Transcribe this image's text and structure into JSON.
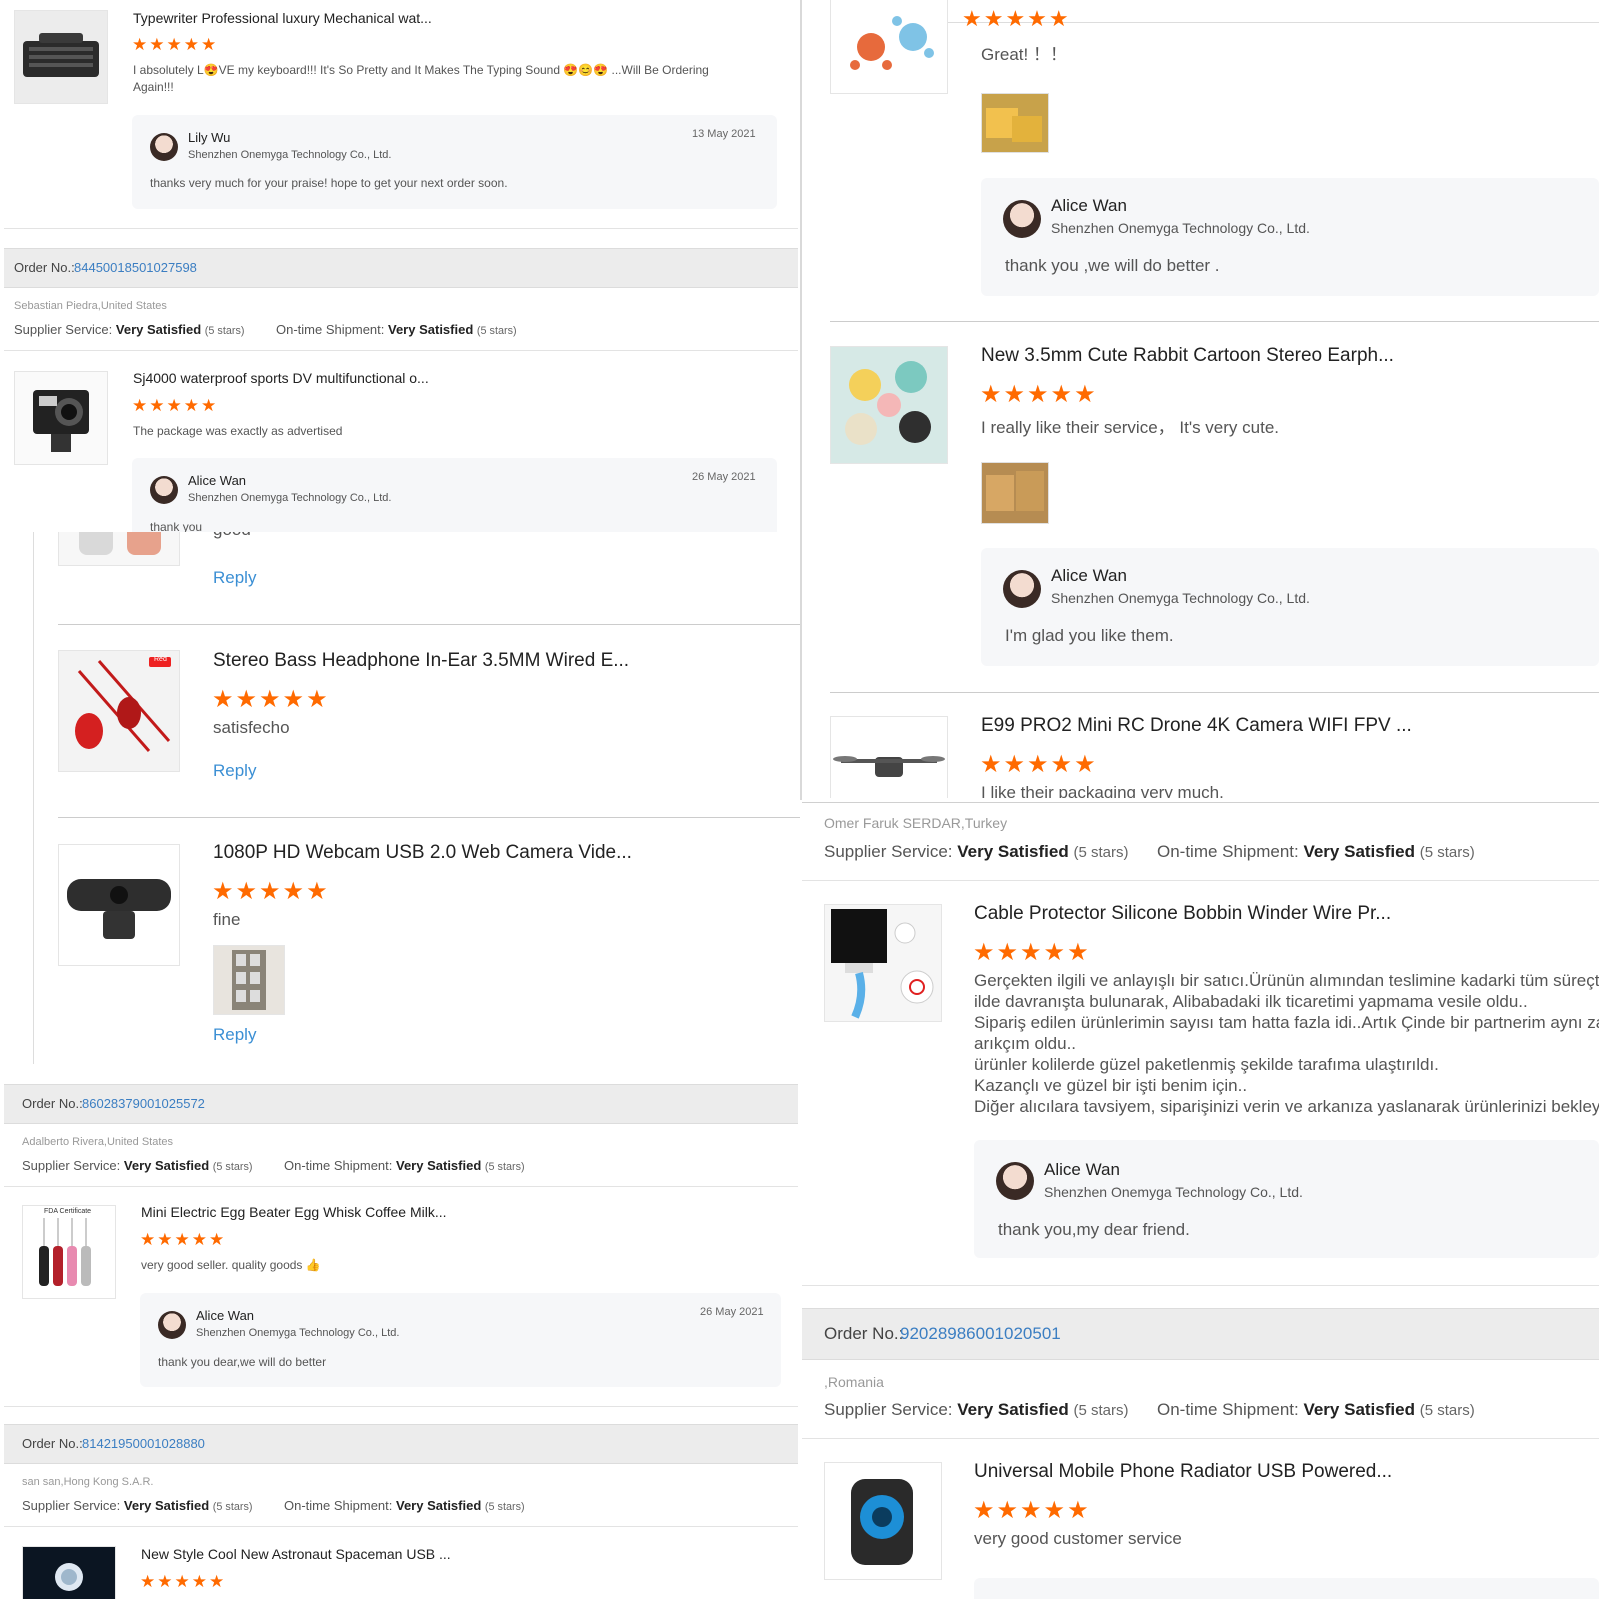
{
  "panel_a": {
    "review1": {
      "title": "Typewriter Professional luxury Mechanical wat...",
      "stars": "★★★★★",
      "text_l1": "I absolutely L😍VE my keyboard!!! It's So Pretty and It Makes The Typing Sound 😍😊😍 ...Will Be Ordering",
      "text_l2": "Again!!!",
      "reply_name": "Lily Wu",
      "reply_company": "Shenzhen Onemyga Technology Co., Ltd.",
      "reply_date": "13 May 2021",
      "reply_text": "thanks very much for your  praise! hope to get your next order soon."
    },
    "order": {
      "label": "Order No.: ",
      "number": "84450018501027598",
      "buyer": "Sebastian Piedra,United States",
      "svc_label": "Supplier Service: ",
      "svc_value": "Very Satisfied",
      "svc_stars": "(5 stars)",
      "ship_label": "On-time Shipment: ",
      "ship_value": "Very Satisfied",
      "ship_stars": "(5 stars)"
    },
    "review2": {
      "title": "Sj4000 waterproof sports DV multifunctional o...",
      "stars": "★★★★★",
      "text": "The package was exactly as advertised",
      "reply_name": "Alice Wan",
      "reply_company": "Shenzhen Onemyga Technology Co., Ltd.",
      "reply_date": "26 May 2021",
      "reply_text": "thank you"
    }
  },
  "panel_b": {
    "partial_text": "good",
    "reply_link": "Reply",
    "item1": {
      "title": "Stereo Bass Headphone In-Ear 3.5MM Wired E...",
      "stars": "★★★★★",
      "text": "satisfecho",
      "reply_link": "Reply",
      "badge": "Red"
    },
    "item2": {
      "title": "1080P HD Webcam USB 2.0 Web Camera Vide...",
      "stars": "★★★★★",
      "text": "fine",
      "reply_link": "Reply"
    }
  },
  "panel_c": {
    "order1": {
      "label": "Order No.: ",
      "number": "86028379001025572",
      "buyer": "Adalberto Rivera,United States",
      "svc_label": "Supplier Service: ",
      "svc_value": "Very Satisfied",
      "svc_stars": "(5 stars)",
      "ship_label": "On-time Shipment: ",
      "ship_value": "Very Satisfied",
      "ship_stars": "(5 stars)"
    },
    "review": {
      "title": "Mini Electric Egg Beater Egg Whisk Coffee Milk...",
      "stars": "★★★★★",
      "text": "very good seller. quality goods 👍",
      "thumb_label": "FDA Certificate",
      "reply_name": "Alice Wan",
      "reply_company": "Shenzhen Onemyga Technology Co., Ltd.",
      "reply_date": "26 May 2021",
      "reply_text": "thank you dear,we will do better"
    },
    "order2": {
      "label": "Order No.: ",
      "number": "81421950001028880",
      "buyer": "san san,Hong Kong S.A.R.",
      "svc_label": "Supplier Service: ",
      "svc_value": "Very Satisfied",
      "svc_stars": "(5 stars)",
      "ship_label": "On-time Shipment: ",
      "ship_value": "Very Satisfied",
      "ship_stars": "(5 stars)"
    },
    "review2": {
      "title": "New Style Cool New Astronaut Spaceman USB ...",
      "stars": "★★★★★"
    }
  },
  "panel_d": {
    "top_stars": "★★★★★",
    "text1": "Great! ！！",
    "reply1": {
      "name": "Alice Wan",
      "company": "Shenzhen Onemyga Technology Co., Ltd.",
      "text": "thank you ,we will do better ."
    },
    "item2": {
      "title": "New 3.5mm Cute Rabbit Cartoon Stereo Earph...",
      "stars": "★★★★★",
      "text": "I really like their service， It's very cute."
    },
    "reply2": {
      "name": "Alice Wan",
      "company": "Shenzhen Onemyga Technology Co., Ltd.",
      "text": "I'm glad you like them."
    },
    "item3": {
      "title": "E99 PRO2 Mini RC Drone 4K Camera WIFI FPV ...",
      "stars": "★★★★★",
      "text": "I like their packaging very much."
    }
  },
  "panel_e": {
    "buyer": "Omer Faruk SERDAR,Turkey",
    "svc_label": "Supplier Service: ",
    "svc_value": "Very Satisfied",
    "svc_stars": "(5 stars)",
    "ship_label": "On-time Shipment: ",
    "ship_value": "Very Satisfied",
    "ship_stars": "(5 stars)",
    "review": {
      "title": "Cable Protector Silicone Bobbin Winder Wire Pr...",
      "stars": "★★★★★",
      "lines": [
        "Gerçekten ilgili ve anlayışlı bir satıcı.Ürünün alımından teslimine kadarki tüm süreçte şe",
        "ilde davranışta bulunarak, Alibabadaki ilk ticaretimi yapmama vesile oldu..",
        "Sipariş edilen ürünlerimin sayısı tam hatta fazla idi..Artık Çinde bir partnerim aynı zama",
        "arıkçım oldu..",
        "ürünler kolilerde güzel paketlenmiş şekilde tarafıma ulaştırıldı.",
        "Kazançlı ve güzel bir işti benim için..",
        "Diğer alıcılara tavsiyem, siparişinizi verin ve arkanıza yaslanarak ürünlerinizi bekleyin.."
      ],
      "reply_name": "Alice Wan",
      "reply_company": "Shenzhen Onemyga Technology Co., Ltd.",
      "reply_text": "thank you,my dear friend."
    },
    "order2": {
      "label": "Order No.: ",
      "number": "92028986001020501",
      "buyer": ",Romania",
      "svc_label": "Supplier Service: ",
      "svc_value": "Very Satisfied",
      "svc_stars": "(5 stars)",
      "ship_label": "On-time Shipment: ",
      "ship_value": "Very Satisfied",
      "ship_stars": "(5 stars)"
    },
    "review2": {
      "title": "Universal Mobile Phone Radiator USB Powered...",
      "stars": "★★★★★",
      "text": "very good customer service"
    }
  },
  "colors": {
    "star": "#ff6a00",
    "link": "#3b8fd4",
    "order_number": "#3b7ec2",
    "order_bar": "#ececec",
    "reply_bg": "#f6f7f9"
  }
}
